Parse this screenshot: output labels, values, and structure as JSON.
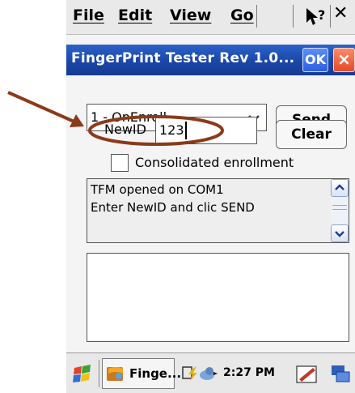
{
  "menu": {
    "file": "File",
    "edit": "Edit",
    "view": "View",
    "go": "Go"
  },
  "window": {
    "title": "FingerPrint Tester Rev 1.0...",
    "ok_label": "OK",
    "close_label": "×"
  },
  "form": {
    "command_selected": "1 - OnEnroll",
    "send_label": "Send",
    "clear_label": "Clear",
    "newid_label": "NewID",
    "newid_value": "123",
    "consolidated_label": "Consolidated enrollment",
    "consolidated_checked": false
  },
  "log": {
    "lines": [
      "TFM opened on COM1",
      "Enter NewID and clic SEND"
    ]
  },
  "taskbar": {
    "task_label": "Finge...",
    "time": "2:27 PM"
  },
  "icons": [
    "windows-start-icon",
    "app-icon",
    "network-icon",
    "speaker-icon",
    "pen-icon",
    "keyboard-icon",
    "help-pointer-icon"
  ],
  "colors": {
    "titlebar": "#1b46a8",
    "annotation": "#8b3a1a"
  }
}
